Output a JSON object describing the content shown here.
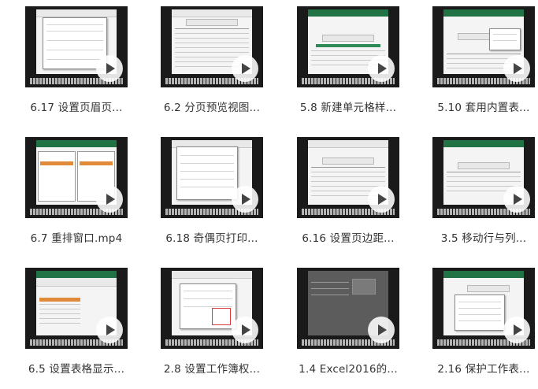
{
  "videos": [
    {
      "title": "6.17 设置页眉页..."
    },
    {
      "title": "6.2 分页预览视图..."
    },
    {
      "title": "5.8 新建单元格样..."
    },
    {
      "title": "5.10 套用内置表..."
    },
    {
      "title": "6.7 重排窗口.mp4"
    },
    {
      "title": "6.18 奇偶页打印..."
    },
    {
      "title": "6.16 设置页边距..."
    },
    {
      "title": "3.5 移动行与列..."
    },
    {
      "title": "6.5 设置表格显示..."
    },
    {
      "title": "2.8 设置工作簿权..."
    },
    {
      "title": "1.4 Excel2016的..."
    },
    {
      "title": "2.16 保护工作表..."
    }
  ]
}
